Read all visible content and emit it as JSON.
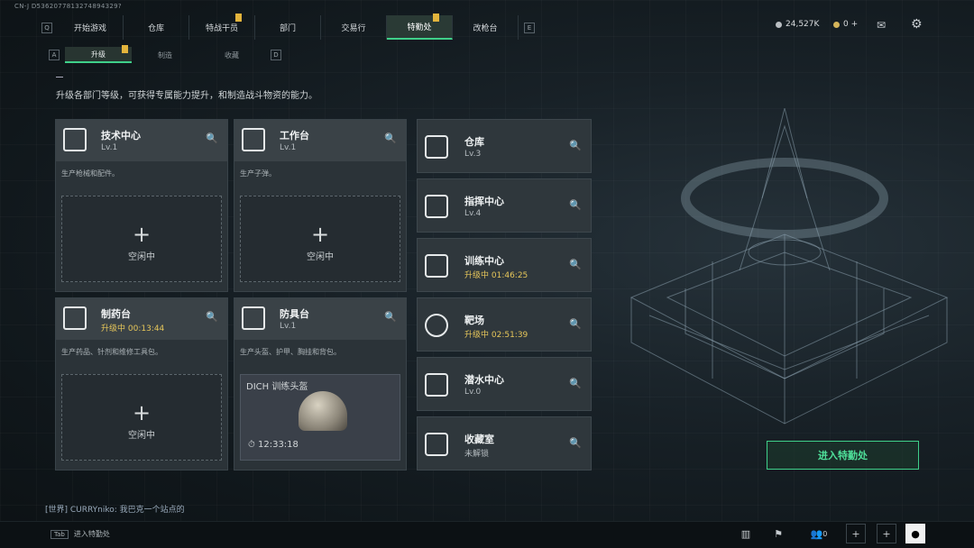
{
  "user_id": "CN-J D5362077813274894329?",
  "nav": {
    "left_key": "Q",
    "right_key": "E",
    "tabs": [
      "开始游戏",
      "仓库",
      "特战干员",
      "部门",
      "交易行",
      "特勤处",
      "改枪台"
    ],
    "active": "特勤处"
  },
  "resources": {
    "money": "24,527K",
    "coins": "0 +"
  },
  "subnav": {
    "left_key": "A",
    "right_key": "D",
    "tabs": [
      "升级",
      "制造",
      "收藏"
    ],
    "active": "升级"
  },
  "description": "升级各部门等级，可获得专属能力提升，和制造战斗物资的能力。",
  "cards": [
    {
      "title": "技术中心",
      "level": "Lv.1",
      "desc": "生产枪械和配件。",
      "slot": "空闲中"
    },
    {
      "title": "工作台",
      "level": "Lv.1",
      "desc": "生产子弹。",
      "slot": "空闲中"
    },
    {
      "title": "制药台",
      "level": "升级中 00:13:44",
      "desc": "生产药品、针剂和维修工具包。",
      "slot": "空闲中"
    },
    {
      "title": "防具台",
      "level": "Lv.1",
      "desc": "生产头盔、护甲、胸挂和背包。",
      "item": "DICH 训练头盔",
      "timer": "12:33:18"
    }
  ],
  "right_cards": [
    {
      "title": "仓库",
      "level": "Lv.3"
    },
    {
      "title": "指挥中心",
      "level": "Lv.4"
    },
    {
      "title": "训练中心",
      "level": "升级中 01:46:25"
    },
    {
      "title": "靶场",
      "level": "升级中 02:51:39"
    },
    {
      "title": "潜水中心",
      "level": "Lv.0"
    },
    {
      "title": "收藏室",
      "level": "未解锁"
    }
  ],
  "enter_button": "进入特勤处",
  "chat": "[世界] CURRYniko: 我巴克一个站点的",
  "bottom": {
    "tab_key": "Tab",
    "tab_label": "进入特勤处",
    "friends": "0"
  }
}
